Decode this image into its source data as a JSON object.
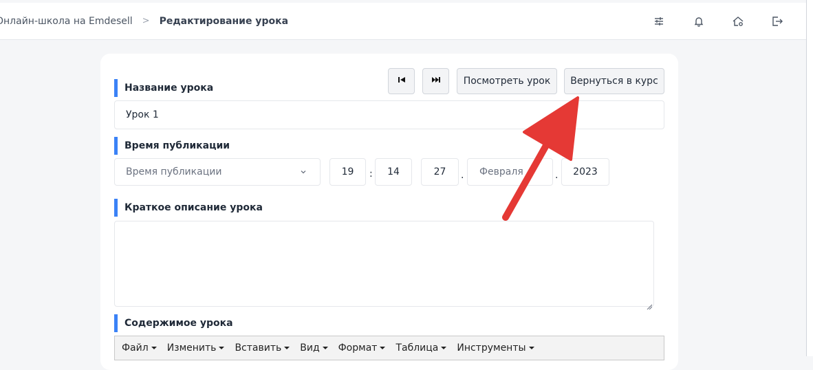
{
  "breadcrumb": {
    "parent": "Онлайн-школа на Emdesell",
    "separator": ">",
    "current": "Редактирование урока"
  },
  "header_icons": [
    "sliders-icon",
    "bell-icon",
    "home-settings-icon",
    "logout-icon"
  ],
  "toolbar": {
    "prev_icon": "skip-previous-icon",
    "next_icon": "skip-next-icon",
    "view_label": "Посмотреть урок",
    "back_label": "Вернуться в курс"
  },
  "lesson_title": {
    "label": "Название урока",
    "value": "Урок 1"
  },
  "publish": {
    "label": "Время публикации",
    "select_placeholder": "Время публикации",
    "hour": "19",
    "minute": "14",
    "time_sep": ":",
    "day": "27",
    "month_placeholder": "Февраля",
    "date_sep": ".",
    "year": "2023"
  },
  "description": {
    "label": "Краткое описание урока",
    "value": ""
  },
  "content": {
    "label": "Содержимое урока",
    "menu": [
      "Файл",
      "Изменить",
      "Вставить",
      "Вид",
      "Формат",
      "Таблица",
      "Инструменты"
    ]
  },
  "colors": {
    "accent": "#3b82f6",
    "annotation_arrow": "#e53935"
  }
}
